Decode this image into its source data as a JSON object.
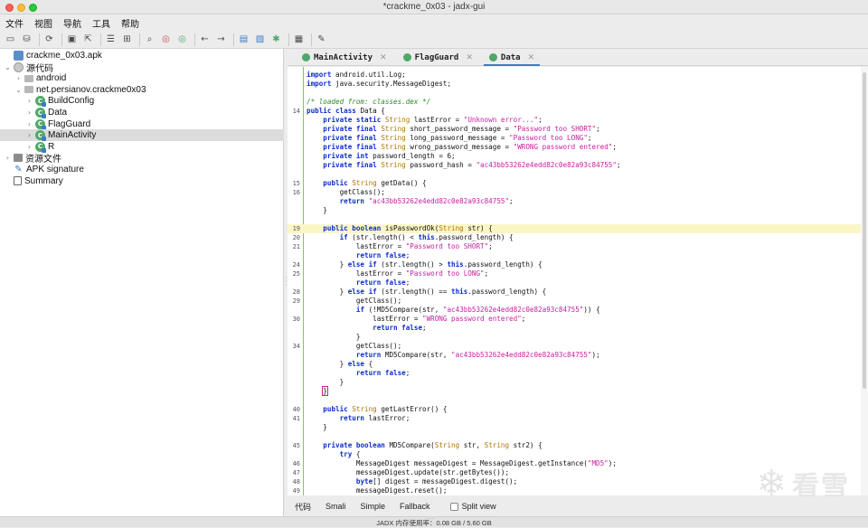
{
  "window": {
    "title": "*crackme_0x03 - jadx-gui"
  },
  "menu": [
    "文件",
    "视图",
    "导航",
    "工具",
    "帮助"
  ],
  "toolbar": {
    "icons": [
      "open-icon",
      "save-all-icon",
      "sync-icon",
      "save-icon",
      "export-icon",
      "flatten-icon",
      "packages-icon",
      "search-icon",
      "search-class-icon",
      "search-usage-icon",
      "back-icon",
      "forward-icon",
      "decompile-icon",
      "deobf-icon",
      "debug-icon",
      "log-icon",
      "prefs-icon"
    ]
  },
  "tree": {
    "items": [
      {
        "label": "crackme_0x03.apk",
        "depth": 0,
        "icon": "apk-icon",
        "chev": ""
      },
      {
        "label": "源代码",
        "depth": 0,
        "icon": "source-root-icon",
        "chev": "⌄"
      },
      {
        "label": "android",
        "depth": 1,
        "icon": "package-icon",
        "chev": "›"
      },
      {
        "label": "net.persianov.crackme0x03",
        "depth": 1,
        "icon": "package-icon",
        "chev": "⌄"
      },
      {
        "label": "BuildConfig",
        "depth": 2,
        "icon": "class-icon",
        "chev": "›"
      },
      {
        "label": "Data",
        "depth": 2,
        "icon": "class-icon",
        "chev": "›"
      },
      {
        "label": "FlagGuard",
        "depth": 2,
        "icon": "class-icon",
        "chev": "›"
      },
      {
        "label": "MainActivity",
        "depth": 2,
        "icon": "class-icon",
        "chev": "›",
        "selected": true
      },
      {
        "label": "R",
        "depth": 2,
        "icon": "class-icon",
        "chev": "›"
      },
      {
        "label": "资源文件",
        "depth": 0,
        "icon": "resources-icon",
        "chev": "›"
      },
      {
        "label": "APK signature",
        "depth": 0,
        "icon": "signature-icon",
        "chev": ""
      },
      {
        "label": "Summary",
        "depth": 0,
        "icon": "summary-icon",
        "chev": ""
      }
    ]
  },
  "tabs": [
    {
      "label": "MainActivity",
      "active": false
    },
    {
      "label": "FlagGuard",
      "active": false
    },
    {
      "label": "Data",
      "active": true
    }
  ],
  "code": {
    "lines": [
      {
        "ln": "",
        "html": "<span class='kw'>import</span> android.util.Log;"
      },
      {
        "ln": "",
        "html": "<span class='kw'>import</span> java.security.MessageDigest;"
      },
      {
        "ln": "",
        "html": ""
      },
      {
        "ln": "",
        "html": "<span class='cm'>/* loaded from: classes.dex */</span>"
      },
      {
        "ln": "14",
        "html": "<span class='kw'>public class</span> Data {"
      },
      {
        "ln": "",
        "html": "    <span class='kw'>private static</span> <span class='ty'>String</span> lastError = <span class='st'>\"Unknown error...\"</span>;"
      },
      {
        "ln": "",
        "html": "    <span class='kw'>private final</span> <span class='ty'>String</span> short_password_message = <span class='st'>\"Password too SHORT\"</span>;"
      },
      {
        "ln": "",
        "html": "    <span class='kw'>private final</span> <span class='ty'>String</span> long_password_message = <span class='st'>\"Password too LONG\"</span>;"
      },
      {
        "ln": "",
        "html": "    <span class='kw'>private final</span> <span class='ty'>String</span> wrong_password_message = <span class='st'>\"WRONG password entered\"</span>;"
      },
      {
        "ln": "",
        "html": "    <span class='kw'>private int</span> password_length = 6;"
      },
      {
        "ln": "",
        "html": "    <span class='kw'>private final</span> <span class='ty'>String</span> password_hash = <span class='st'>\"ac43bb53262e4edd82c0e82a93c84755\"</span>;"
      },
      {
        "ln": "",
        "html": ""
      },
      {
        "ln": "15",
        "html": "    <span class='kw'>public</span> <span class='ty'>String</span> getData() {"
      },
      {
        "ln": "16",
        "html": "        getClass();"
      },
      {
        "ln": "",
        "html": "        <span class='kw'>return</span> <span class='st'>\"ac43bb53262e4edd82c0e82a93c84755\"</span>;"
      },
      {
        "ln": "",
        "html": "    }"
      },
      {
        "ln": "",
        "html": ""
      },
      {
        "ln": "19",
        "html": "    <span class='kw'>public boolean</span> isPasswordOk(<span class='ty'>String</span> str) {",
        "hl": true
      },
      {
        "ln": "20",
        "html": "        <span class='kw'>if</span> (str.length() &lt; <span class='kw'>this</span>.password_length) {"
      },
      {
        "ln": "21",
        "html": "            lastError = <span class='st'>\"Password too SHORT\"</span>;"
      },
      {
        "ln": "",
        "html": "            <span class='kw'>return false</span>;"
      },
      {
        "ln": "24",
        "html": "        } <span class='kw'>else if</span> (str.length() &gt; <span class='kw'>this</span>.password_length) {"
      },
      {
        "ln": "25",
        "html": "            lastError = <span class='st'>\"Password too LONG\"</span>;"
      },
      {
        "ln": "",
        "html": "            <span class='kw'>return false</span>;"
      },
      {
        "ln": "28",
        "html": "        } <span class='kw'>else if</span> (str.length() == <span class='kw'>this</span>.password_length) {"
      },
      {
        "ln": "29",
        "html": "            getClass();"
      },
      {
        "ln": "",
        "html": "            <span class='kw'>if</span> (!MD5Compare(str, <span class='st'>\"ac43bb53262e4edd82c0e82a93c84755\"</span>)) {"
      },
      {
        "ln": "30",
        "html": "                lastError = <span class='st'>\"WRONG password entered\"</span>;"
      },
      {
        "ln": "",
        "html": "                <span class='kw'>return false</span>;"
      },
      {
        "ln": "",
        "html": "            }"
      },
      {
        "ln": "34",
        "html": "            getClass();"
      },
      {
        "ln": "",
        "html": "            <span class='kw'>return</span> MD5Compare(str, <span class='st'>\"ac43bb53262e4edd82c0e82a93c84755\"</span>);"
      },
      {
        "ln": "",
        "html": "        } <span class='kw'>else</span> {"
      },
      {
        "ln": "",
        "html": "            <span class='kw'>return false</span>;"
      },
      {
        "ln": "",
        "html": "        }"
      },
      {
        "ln": "",
        "html": "    <span class='bracket-box'>}</span>"
      },
      {
        "ln": "",
        "html": ""
      },
      {
        "ln": "40",
        "html": "    <span class='kw'>public</span> <span class='ty'>String</span> getLastError() {"
      },
      {
        "ln": "41",
        "html": "        <span class='kw'>return</span> lastError;"
      },
      {
        "ln": "",
        "html": "    }"
      },
      {
        "ln": "",
        "html": ""
      },
      {
        "ln": "45",
        "html": "    <span class='kw'>private boolean</span> MD5Compare(<span class='ty'>String</span> str, <span class='ty'>String</span> str2) {"
      },
      {
        "ln": "",
        "html": "        <span class='kw'>try</span> {"
      },
      {
        "ln": "46",
        "html": "            MessageDigest messageDigest = MessageDigest.getInstance(<span class='st'>\"MD5\"</span>);"
      },
      {
        "ln": "47",
        "html": "            messageDigest.update(str.getBytes());"
      },
      {
        "ln": "48",
        "html": "            <span class='kw'>byte</span>[] digest = messageDigest.digest();"
      },
      {
        "ln": "49",
        "html": "            messageDigest.reset();"
      }
    ]
  },
  "mode_tabs": [
    "代码",
    "Smali",
    "Simple",
    "Fallback"
  ],
  "split_view_label": "Split view",
  "status": {
    "memory": "JADX 内存使用率：0.08 GB / 5.60 GB"
  },
  "watermark": {
    "text": "看雪"
  }
}
